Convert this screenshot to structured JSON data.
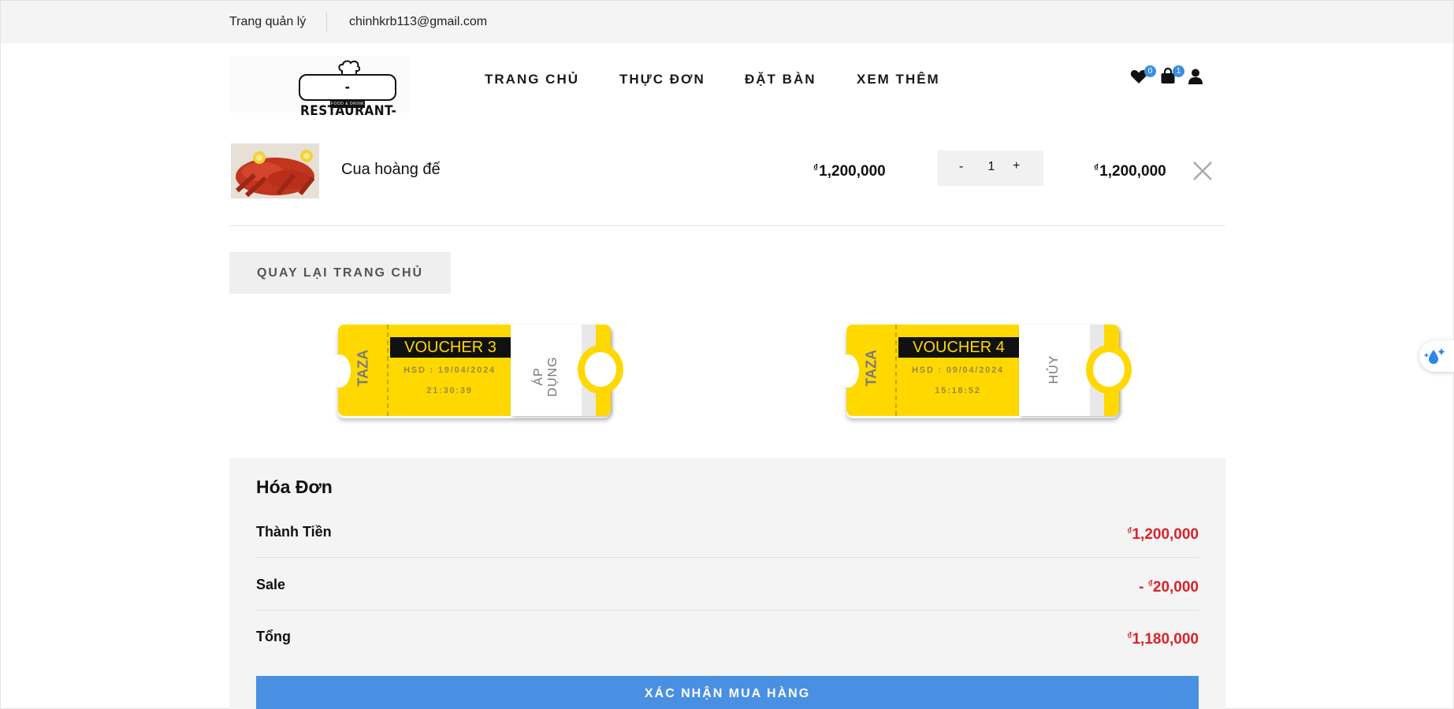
{
  "topbar": {
    "admin_link": "Trang quản lý",
    "email": "chinhkrb113@gmail.com"
  },
  "logo": {
    "text": "-RESTAURANT-",
    "subtext": "FOOD & DRINK"
  },
  "nav": [
    {
      "label": "TRANG CHỦ"
    },
    {
      "label": "THỰC ĐƠN"
    },
    {
      "label": "ĐẶT BÀN"
    },
    {
      "label": "XEM THÊM"
    }
  ],
  "header_icons": {
    "wishlist": {
      "icon": "heart-icon",
      "count": "0"
    },
    "cart": {
      "icon": "shopping-bag-icon",
      "count": "1"
    },
    "account": {
      "icon": "user-icon"
    }
  },
  "cart": {
    "items": [
      {
        "name": "Cua hoàng đế",
        "currency": "₫",
        "unit_price": "1,200,000",
        "quantity": "1",
        "total": "1,200,000"
      }
    ],
    "qty_minus": "-",
    "qty_plus": "+",
    "back_button": "QUAY LẠI TRANG CHỦ"
  },
  "vouchers": [
    {
      "brand": "TAZA",
      "title": "VOUCHER 3",
      "expiry": "HSD : 19/04/2024",
      "time": "21:30:39",
      "action": "ÁP DỤNG"
    },
    {
      "brand": "TAZA",
      "title": "VOUCHER 4",
      "expiry": "HSD : 09/04/2024",
      "time": "15:18:52",
      "action": "HỦY"
    }
  ],
  "invoice": {
    "title": "Hóa Đơn",
    "rows": [
      {
        "label": "Thành Tiền",
        "prefix": "",
        "currency": "₫",
        "value": "1,200,000"
      },
      {
        "label": "Sale",
        "prefix": "- ",
        "currency": "₫",
        "value": "20,000"
      },
      {
        "label": "Tổng",
        "prefix": "",
        "currency": "₫",
        "value": "1,180,000"
      }
    ],
    "confirm_button": "XÁC NHẬN MUA HÀNG"
  },
  "colors": {
    "accent_blue": "#4a90e2",
    "voucher_yellow": "#ffd800",
    "price_red": "#d8232a",
    "badge_blue": "#3a8de3"
  }
}
